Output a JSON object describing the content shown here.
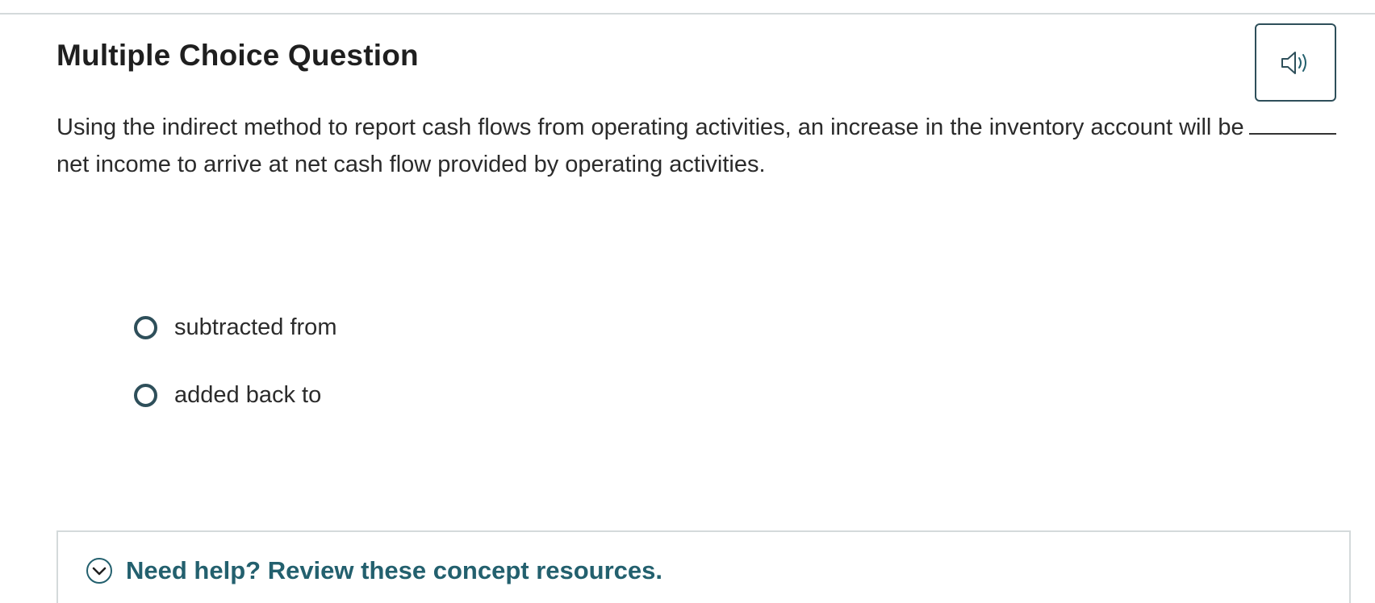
{
  "question": {
    "heading": "Multiple Choice Question",
    "text_before_blank": "Using the indirect method to report cash flows from operating activities, an increase in the inventory account will be",
    "text_after_blank": "net income to arrive at net cash flow provided by operating activities."
  },
  "audio": {
    "icon": "speaker-icon"
  },
  "options": [
    {
      "label": "subtracted from",
      "selected": false
    },
    {
      "label": "added back to",
      "selected": false
    }
  ],
  "help": {
    "label": "Need help? Review these concept resources.",
    "icon": "chevron-down-circle-icon"
  },
  "colors": {
    "accent": "#23606e",
    "radio_border": "#2e4f5a",
    "divider": "#d4dadb"
  }
}
